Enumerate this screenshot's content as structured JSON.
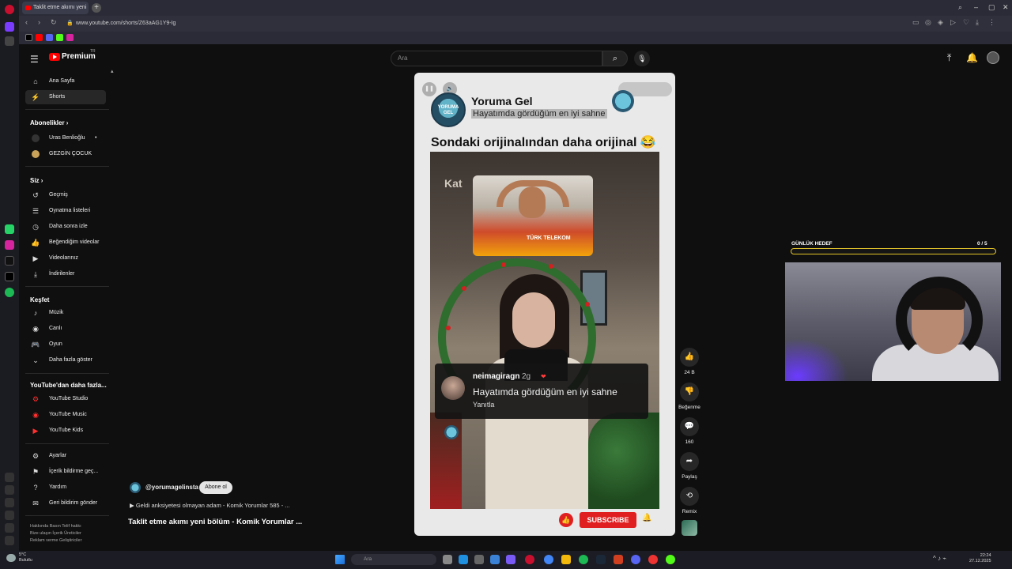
{
  "browser": {
    "tab_title": "Taklit etme akımı yeni",
    "url": "www.youtube.com/shorts/Z63aAG1Y9-Ig",
    "new_tab_label": "+"
  },
  "header": {
    "brand": "Premium",
    "brand_superscript": "TR",
    "search_placeholder": "Ara",
    "icons": [
      "menu-icon",
      "search-icon",
      "mic-icon",
      "upload-icon",
      "bell-icon",
      "avatar"
    ]
  },
  "sidebar": {
    "top_items": [
      {
        "label": "Ana Sayfa",
        "icon": "home-icon"
      },
      {
        "label": "Shorts",
        "icon": "shorts-icon"
      }
    ],
    "subscriptions_title": "Abonelikler",
    "subscriptions": [
      {
        "label": "Uras Benlioğlu",
        "live_dot": "•"
      },
      {
        "label": "GEZGİN ÇOCUK"
      }
    ],
    "you_title": "Siz",
    "you_items": [
      {
        "label": "Geçmiş",
        "icon": "history-icon"
      },
      {
        "label": "Oynatma listeleri",
        "icon": "playlist-icon"
      },
      {
        "label": "Daha sonra izle",
        "icon": "clock-icon"
      },
      {
        "label": "Beğendiğim videolar",
        "icon": "thumb-up-icon"
      },
      {
        "label": "Videolarınız",
        "icon": "video-icon"
      },
      {
        "label": "İndirilenler",
        "icon": "download-icon"
      }
    ],
    "explore_title": "Keşfet",
    "explore_items": [
      {
        "label": "Müzik",
        "icon": "music-icon"
      },
      {
        "label": "Canlı",
        "icon": "live-icon"
      },
      {
        "label": "Oyun",
        "icon": "gaming-icon"
      },
      {
        "label": "Daha fazla göster",
        "icon": "chevron-down-icon"
      }
    ],
    "more_title": "YouTube'dan daha fazla...",
    "more_items": [
      {
        "label": "YouTube Studio"
      },
      {
        "label": "YouTube Music"
      },
      {
        "label": "YouTube Kids"
      }
    ],
    "settings_items": [
      {
        "label": "Ayarlar",
        "icon": "gear-icon"
      },
      {
        "label": "İçerik bildirme geç...",
        "icon": "flag-icon"
      },
      {
        "label": "Yardım",
        "icon": "help-icon"
      },
      {
        "label": "Geri bildirim gönder",
        "icon": "feedback-icon"
      }
    ],
    "footer_lines": [
      "Hakkında  Basın  Telif hakkı",
      "Bize ulaşın  İçerik Üreticiler",
      "Reklam verme  Geliştiriciler"
    ]
  },
  "short": {
    "channel_name": "Yoruma Gel",
    "avatar_text": "YORUMA GEL",
    "subtitle": "Hayatımda gördüğüm en iyi sahne",
    "video_title": "Sondaki orijinalından daha orijinal 😂",
    "sign_text": "Kat",
    "inset_badge": "TÜRK TELEKOM",
    "comment": {
      "user": "neimagiragn",
      "age": "2g",
      "heart": "❤",
      "text": "Hayatımda gördüğüm en iyi sahne",
      "reply_label": "Yanıtla"
    },
    "subscribe_label": "SUBSCRIBE"
  },
  "actions": [
    {
      "label": "24 B",
      "icon": "thumb-up-icon"
    },
    {
      "label": "Beğenme",
      "icon": "thumb-down-icon"
    },
    {
      "label": "160",
      "icon": "comment-icon"
    },
    {
      "label": "Paylaş",
      "icon": "share-icon"
    },
    {
      "label": "Remix",
      "icon": "remix-icon"
    }
  ],
  "below": {
    "handle": "@yorumagelinsta",
    "subscribe_pill": "Abone ol",
    "playlist_line": "▶ Geldi anksiyetesi olmayan adam - Komik Yorumlar 585 - ...",
    "title": "Taklit etme akımı yeni bölüm - Komik Yorumlar ..."
  },
  "goal": {
    "label": "GÜNLÜK HEDEF",
    "count": "0 / 5",
    "progress": 0,
    "color": "#e6c52a"
  },
  "taskbar": {
    "weather_temp": "5°C",
    "weather_desc": "Bulutlu",
    "search_placeholder": "Ara",
    "time": "22:24",
    "date": "27.12.2025"
  },
  "colors": {
    "accent_red": "#ff0000",
    "subscribe_red": "#e02020",
    "background": "#0f0f0f"
  }
}
